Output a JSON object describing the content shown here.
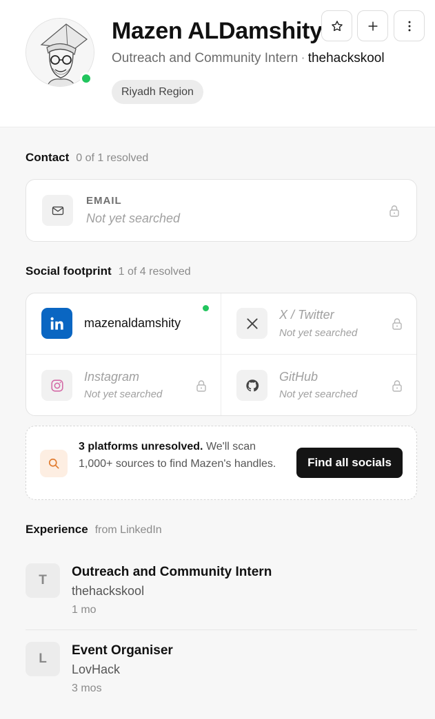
{
  "profile": {
    "name": "Mazen ALDamshity",
    "role": "Outreach and Community Intern",
    "separator": "·",
    "company": "thehackskool",
    "region": "Riyadh Region",
    "online": true
  },
  "header_actions": [
    {
      "icon": "star-icon"
    },
    {
      "icon": "plus-icon"
    },
    {
      "icon": "more-vertical-icon"
    }
  ],
  "contact": {
    "title": "Contact",
    "meta": "0 of 1 resolved",
    "email_label": "EMAIL",
    "email_value": "Not yet searched"
  },
  "social": {
    "title": "Social footprint",
    "meta": "1 of 4 resolved",
    "linkedin_handle": "mazenaldamshity",
    "twitter_name": "X / Twitter",
    "twitter_status": "Not yet searched",
    "instagram_name": "Instagram",
    "instagram_status": "Not yet searched",
    "github_name": "GitHub",
    "github_status": "Not yet searched"
  },
  "cta": {
    "bold": "3 platforms unresolved.",
    "text": " We'll scan 1,000+ sources to find Mazen's handles.",
    "button": "Find all socials"
  },
  "experience": {
    "title": "Experience",
    "meta": "from LinkedIn",
    "items": [
      {
        "initial": "T",
        "title": "Outreach and Community Intern",
        "company": "thehackskool",
        "duration": "1 mo"
      },
      {
        "initial": "L",
        "title": "Event Organiser",
        "company": "LovHack",
        "duration": "3 mos"
      }
    ]
  },
  "colors": {
    "online": "#22c55e",
    "linkedin": "#0a66c2",
    "button": "#141414",
    "cta_icon_bg": "#fdeee2"
  }
}
